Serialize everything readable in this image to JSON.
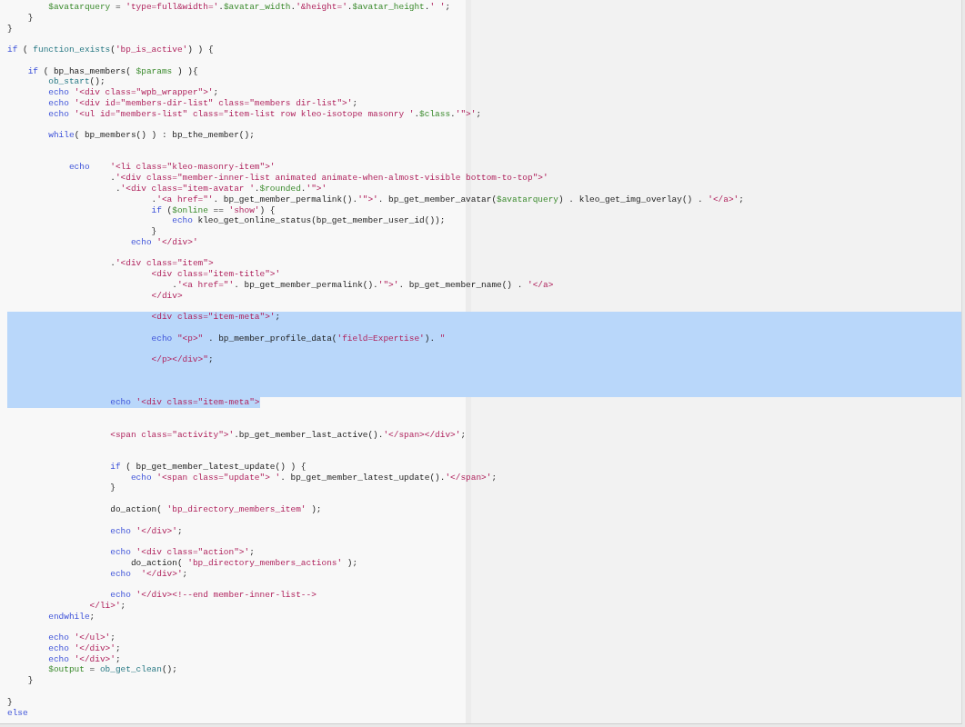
{
  "editor": {
    "lines": [
      {
        "kind": "code",
        "selected": false,
        "tokens": [
          {
            "kind": "var",
            "text": "        $avatarquery"
          },
          {
            "kind": "plain",
            "text": " = "
          },
          {
            "kind": "str",
            "text": "'type=full&width='"
          },
          {
            "kind": "plain",
            "text": "."
          },
          {
            "kind": "var",
            "text": "$avatar_width"
          },
          {
            "kind": "plain",
            "text": "."
          },
          {
            "kind": "str",
            "text": "'&height='"
          },
          {
            "kind": "plain",
            "text": "."
          },
          {
            "kind": "var",
            "text": "$avatar_height"
          },
          {
            "kind": "plain",
            "text": "."
          },
          {
            "kind": "str",
            "text": "' '"
          },
          {
            "kind": "plain",
            "text": ";"
          }
        ]
      },
      {
        "kind": "code",
        "selected": false,
        "tokens": [
          {
            "kind": "plain",
            "text": "    }"
          }
        ]
      },
      {
        "kind": "code",
        "selected": false,
        "tokens": [
          {
            "kind": "plain",
            "text": "}"
          }
        ]
      },
      {
        "kind": "blank",
        "selected": false
      },
      {
        "kind": "code",
        "selected": false,
        "tokens": [
          {
            "kind": "kw",
            "text": "if"
          },
          {
            "kind": "plain",
            "text": " ( "
          },
          {
            "kind": "fn",
            "text": "function_exists"
          },
          {
            "kind": "plain",
            "text": "("
          },
          {
            "kind": "str",
            "text": "'bp_is_active'"
          },
          {
            "kind": "plain",
            "text": ") ) {"
          }
        ]
      },
      {
        "kind": "blank",
        "selected": false
      },
      {
        "kind": "code",
        "selected": false,
        "tokens": [
          {
            "kind": "kw",
            "text": "    if"
          },
          {
            "kind": "plain",
            "text": " ( bp_has_members( "
          },
          {
            "kind": "var",
            "text": "$params"
          },
          {
            "kind": "plain",
            "text": " ) ){"
          }
        ]
      },
      {
        "kind": "code",
        "selected": false,
        "tokens": [
          {
            "kind": "fn",
            "text": "        ob_start"
          },
          {
            "kind": "plain",
            "text": "();"
          }
        ]
      },
      {
        "kind": "code",
        "selected": false,
        "tokens": [
          {
            "kind": "kw",
            "text": "        echo "
          },
          {
            "kind": "str",
            "text": "'<div class=\"wpb_wrapper\">'"
          },
          {
            "kind": "plain",
            "text": ";"
          }
        ]
      },
      {
        "kind": "code",
        "selected": false,
        "tokens": [
          {
            "kind": "kw",
            "text": "        echo "
          },
          {
            "kind": "str",
            "text": "'<div id=\"members-dir-list\" class=\"members dir-list\">'"
          },
          {
            "kind": "plain",
            "text": ";"
          }
        ]
      },
      {
        "kind": "code",
        "selected": false,
        "tokens": [
          {
            "kind": "kw",
            "text": "        echo "
          },
          {
            "kind": "str",
            "text": "'<ul id=\"members-list\" class=\"item-list row kleo-isotope masonry '"
          },
          {
            "kind": "plain",
            "text": "."
          },
          {
            "kind": "var",
            "text": "$class"
          },
          {
            "kind": "plain",
            "text": "."
          },
          {
            "kind": "str",
            "text": "'\">'"
          },
          {
            "kind": "plain",
            "text": ";"
          }
        ]
      },
      {
        "kind": "blank",
        "selected": false
      },
      {
        "kind": "code",
        "selected": false,
        "tokens": [
          {
            "kind": "kw",
            "text": "        while"
          },
          {
            "kind": "plain",
            "text": "( bp_members() ) : bp_the_member();"
          }
        ]
      },
      {
        "kind": "blank",
        "selected": false
      },
      {
        "kind": "blank",
        "selected": false
      },
      {
        "kind": "code",
        "selected": false,
        "tokens": [
          {
            "kind": "kw",
            "text": "            echo    "
          },
          {
            "kind": "str",
            "text": "'<li class=\"kleo-masonry-item\">'"
          }
        ]
      },
      {
        "kind": "code",
        "selected": false,
        "tokens": [
          {
            "kind": "plain",
            "text": "                    ."
          },
          {
            "kind": "str",
            "text": "'<div class=\"member-inner-list animated animate-when-almost-visible bottom-to-top\">'"
          }
        ]
      },
      {
        "kind": "code",
        "selected": false,
        "tokens": [
          {
            "kind": "plain",
            "text": "                     ."
          },
          {
            "kind": "str",
            "text": "'<div class=\"item-avatar '"
          },
          {
            "kind": "plain",
            "text": "."
          },
          {
            "kind": "var",
            "text": "$rounded"
          },
          {
            "kind": "plain",
            "text": "."
          },
          {
            "kind": "str",
            "text": "'\">'"
          }
        ]
      },
      {
        "kind": "code",
        "selected": false,
        "tokens": [
          {
            "kind": "plain",
            "text": "                            ."
          },
          {
            "kind": "str",
            "text": "'<a href=\"'"
          },
          {
            "kind": "plain",
            "text": ". bp_get_member_permalink()."
          },
          {
            "kind": "str",
            "text": "'\">'"
          },
          {
            "kind": "plain",
            "text": ". bp_get_member_avatar("
          },
          {
            "kind": "var",
            "text": "$avatarquery"
          },
          {
            "kind": "plain",
            "text": ") . kleo_get_img_overlay() . "
          },
          {
            "kind": "str",
            "text": "'</a>'"
          },
          {
            "kind": "plain",
            "text": ";"
          }
        ]
      },
      {
        "kind": "code",
        "selected": false,
        "tokens": [
          {
            "kind": "kw",
            "text": "                            if"
          },
          {
            "kind": "plain",
            "text": " ("
          },
          {
            "kind": "var",
            "text": "$online"
          },
          {
            "kind": "plain",
            "text": " == "
          },
          {
            "kind": "str",
            "text": "'show'"
          },
          {
            "kind": "plain",
            "text": ") {"
          }
        ]
      },
      {
        "kind": "code",
        "selected": false,
        "tokens": [
          {
            "kind": "kw",
            "text": "                                echo"
          },
          {
            "kind": "plain",
            "text": " kleo_get_online_status(bp_get_member_user_id());"
          }
        ]
      },
      {
        "kind": "code",
        "selected": false,
        "tokens": [
          {
            "kind": "plain",
            "text": "                            }"
          }
        ]
      },
      {
        "kind": "code",
        "selected": false,
        "tokens": [
          {
            "kind": "kw",
            "text": "                        echo "
          },
          {
            "kind": "str",
            "text": "'</div>'"
          }
        ]
      },
      {
        "kind": "blank",
        "selected": false
      },
      {
        "kind": "code",
        "selected": false,
        "tokens": [
          {
            "kind": "plain",
            "text": "                    ."
          },
          {
            "kind": "str",
            "text": "'<div class=\"item\">"
          }
        ]
      },
      {
        "kind": "code",
        "selected": false,
        "tokens": [
          {
            "kind": "str",
            "text": "                            <div class=\"item-title\">'"
          }
        ]
      },
      {
        "kind": "code",
        "selected": false,
        "tokens": [
          {
            "kind": "plain",
            "text": "                                ."
          },
          {
            "kind": "str",
            "text": "'<a href=\"'"
          },
          {
            "kind": "plain",
            "text": ". bp_get_member_permalink()."
          },
          {
            "kind": "str",
            "text": "'\">'"
          },
          {
            "kind": "plain",
            "text": ". bp_get_member_name() . "
          },
          {
            "kind": "str",
            "text": "'</a>"
          }
        ]
      },
      {
        "kind": "code",
        "selected": false,
        "tokens": [
          {
            "kind": "str",
            "text": "                            </div>"
          }
        ]
      },
      {
        "kind": "blank",
        "selected": false
      },
      {
        "kind": "code",
        "selected": true,
        "tokens": [
          {
            "kind": "str",
            "text": "                            <div class=\"item-meta\">'"
          },
          {
            "kind": "plain",
            "text": ";"
          }
        ]
      },
      {
        "kind": "blank",
        "selected": true
      },
      {
        "kind": "code",
        "selected": true,
        "tokens": [
          {
            "kind": "kw",
            "text": "                            echo "
          },
          {
            "kind": "str",
            "text": "\"<p>\""
          },
          {
            "kind": "plain",
            "text": " . bp_member_profile_data("
          },
          {
            "kind": "str",
            "text": "'field=Expertise'"
          },
          {
            "kind": "plain",
            "text": "). "
          },
          {
            "kind": "str",
            "text": "\""
          }
        ]
      },
      {
        "kind": "blank",
        "selected": true
      },
      {
        "kind": "code",
        "selected": true,
        "tokens": [
          {
            "kind": "str",
            "text": "                            </p></div>\""
          },
          {
            "kind": "plain",
            "text": ";"
          }
        ]
      },
      {
        "kind": "blank",
        "selected": true
      },
      {
        "kind": "blank",
        "selected": true
      },
      {
        "kind": "blank",
        "selected": true
      },
      {
        "kind": "code",
        "selected": true,
        "tokens": [
          {
            "kind": "kw",
            "text": "                    echo "
          },
          {
            "kind": "str",
            "text": "'<div class=\"item-meta\">"
          }
        ]
      },
      {
        "kind": "blank",
        "selected": false
      },
      {
        "kind": "blank",
        "selected": false
      },
      {
        "kind": "code",
        "selected": false,
        "tokens": [
          {
            "kind": "str",
            "text": "                    <span class=\"activity\">'"
          },
          {
            "kind": "plain",
            "text": ".bp_get_member_last_active()."
          },
          {
            "kind": "str",
            "text": "'</span></div>'"
          },
          {
            "kind": "plain",
            "text": ";"
          }
        ]
      },
      {
        "kind": "blank",
        "selected": false
      },
      {
        "kind": "blank",
        "selected": false
      },
      {
        "kind": "code",
        "selected": false,
        "tokens": [
          {
            "kind": "kw",
            "text": "                    if"
          },
          {
            "kind": "plain",
            "text": " ( bp_get_member_latest_update() ) {"
          }
        ]
      },
      {
        "kind": "code",
        "selected": false,
        "tokens": [
          {
            "kind": "kw",
            "text": "                        echo "
          },
          {
            "kind": "str",
            "text": "'<span class=\"update\"> '"
          },
          {
            "kind": "plain",
            "text": ". bp_get_member_latest_update()."
          },
          {
            "kind": "str",
            "text": "'</span>'"
          },
          {
            "kind": "plain",
            "text": ";"
          }
        ]
      },
      {
        "kind": "code",
        "selected": false,
        "tokens": [
          {
            "kind": "plain",
            "text": "                    }"
          }
        ]
      },
      {
        "kind": "blank",
        "selected": false
      },
      {
        "kind": "code",
        "selected": false,
        "tokens": [
          {
            "kind": "plain",
            "text": "                    do_action( "
          },
          {
            "kind": "str",
            "text": "'bp_directory_members_item'"
          },
          {
            "kind": "plain",
            "text": " );"
          }
        ]
      },
      {
        "kind": "blank",
        "selected": false
      },
      {
        "kind": "code",
        "selected": false,
        "tokens": [
          {
            "kind": "kw",
            "text": "                    echo "
          },
          {
            "kind": "str",
            "text": "'</div>'"
          },
          {
            "kind": "plain",
            "text": ";"
          }
        ]
      },
      {
        "kind": "blank",
        "selected": false
      },
      {
        "kind": "code",
        "selected": false,
        "tokens": [
          {
            "kind": "kw",
            "text": "                    echo "
          },
          {
            "kind": "str",
            "text": "'<div class=\"action\">'"
          },
          {
            "kind": "plain",
            "text": ";"
          }
        ]
      },
      {
        "kind": "code",
        "selected": false,
        "tokens": [
          {
            "kind": "plain",
            "text": "                        do_action( "
          },
          {
            "kind": "str",
            "text": "'bp_directory_members_actions'"
          },
          {
            "kind": "plain",
            "text": " );"
          }
        ]
      },
      {
        "kind": "code",
        "selected": false,
        "tokens": [
          {
            "kind": "kw",
            "text": "                    echo  "
          },
          {
            "kind": "str",
            "text": "'</div>'"
          },
          {
            "kind": "plain",
            "text": ";"
          }
        ]
      },
      {
        "kind": "blank",
        "selected": false
      },
      {
        "kind": "code",
        "selected": false,
        "tokens": [
          {
            "kind": "kw",
            "text": "                    echo "
          },
          {
            "kind": "str",
            "text": "'</div><!--end member-inner-list-->"
          }
        ]
      },
      {
        "kind": "code",
        "selected": false,
        "tokens": [
          {
            "kind": "str",
            "text": "                </li>'"
          },
          {
            "kind": "plain",
            "text": ";"
          }
        ]
      },
      {
        "kind": "code",
        "selected": false,
        "tokens": [
          {
            "kind": "kw",
            "text": "        endwhile"
          },
          {
            "kind": "plain",
            "text": ";"
          }
        ]
      },
      {
        "kind": "blank",
        "selected": false
      },
      {
        "kind": "code",
        "selected": false,
        "tokens": [
          {
            "kind": "kw",
            "text": "        echo "
          },
          {
            "kind": "str",
            "text": "'</ul>'"
          },
          {
            "kind": "plain",
            "text": ";"
          }
        ]
      },
      {
        "kind": "code",
        "selected": false,
        "tokens": [
          {
            "kind": "kw",
            "text": "        echo "
          },
          {
            "kind": "str",
            "text": "'</div>'"
          },
          {
            "kind": "plain",
            "text": ";"
          }
        ]
      },
      {
        "kind": "code",
        "selected": false,
        "tokens": [
          {
            "kind": "kw",
            "text": "        echo "
          },
          {
            "kind": "str",
            "text": "'</div>'"
          },
          {
            "kind": "plain",
            "text": ";"
          }
        ]
      },
      {
        "kind": "code",
        "selected": false,
        "tokens": [
          {
            "kind": "var",
            "text": "        $output"
          },
          {
            "kind": "plain",
            "text": " = "
          },
          {
            "kind": "fn",
            "text": "ob_get_clean"
          },
          {
            "kind": "plain",
            "text": "();"
          }
        ]
      },
      {
        "kind": "code",
        "selected": false,
        "tokens": [
          {
            "kind": "plain",
            "text": "    }"
          }
        ]
      },
      {
        "kind": "blank",
        "selected": false
      },
      {
        "kind": "code",
        "selected": false,
        "tokens": [
          {
            "kind": "plain",
            "text": "}"
          }
        ]
      },
      {
        "kind": "code",
        "selected": false,
        "tokens": [
          {
            "kind": "kw",
            "text": "else"
          }
        ]
      }
    ]
  }
}
